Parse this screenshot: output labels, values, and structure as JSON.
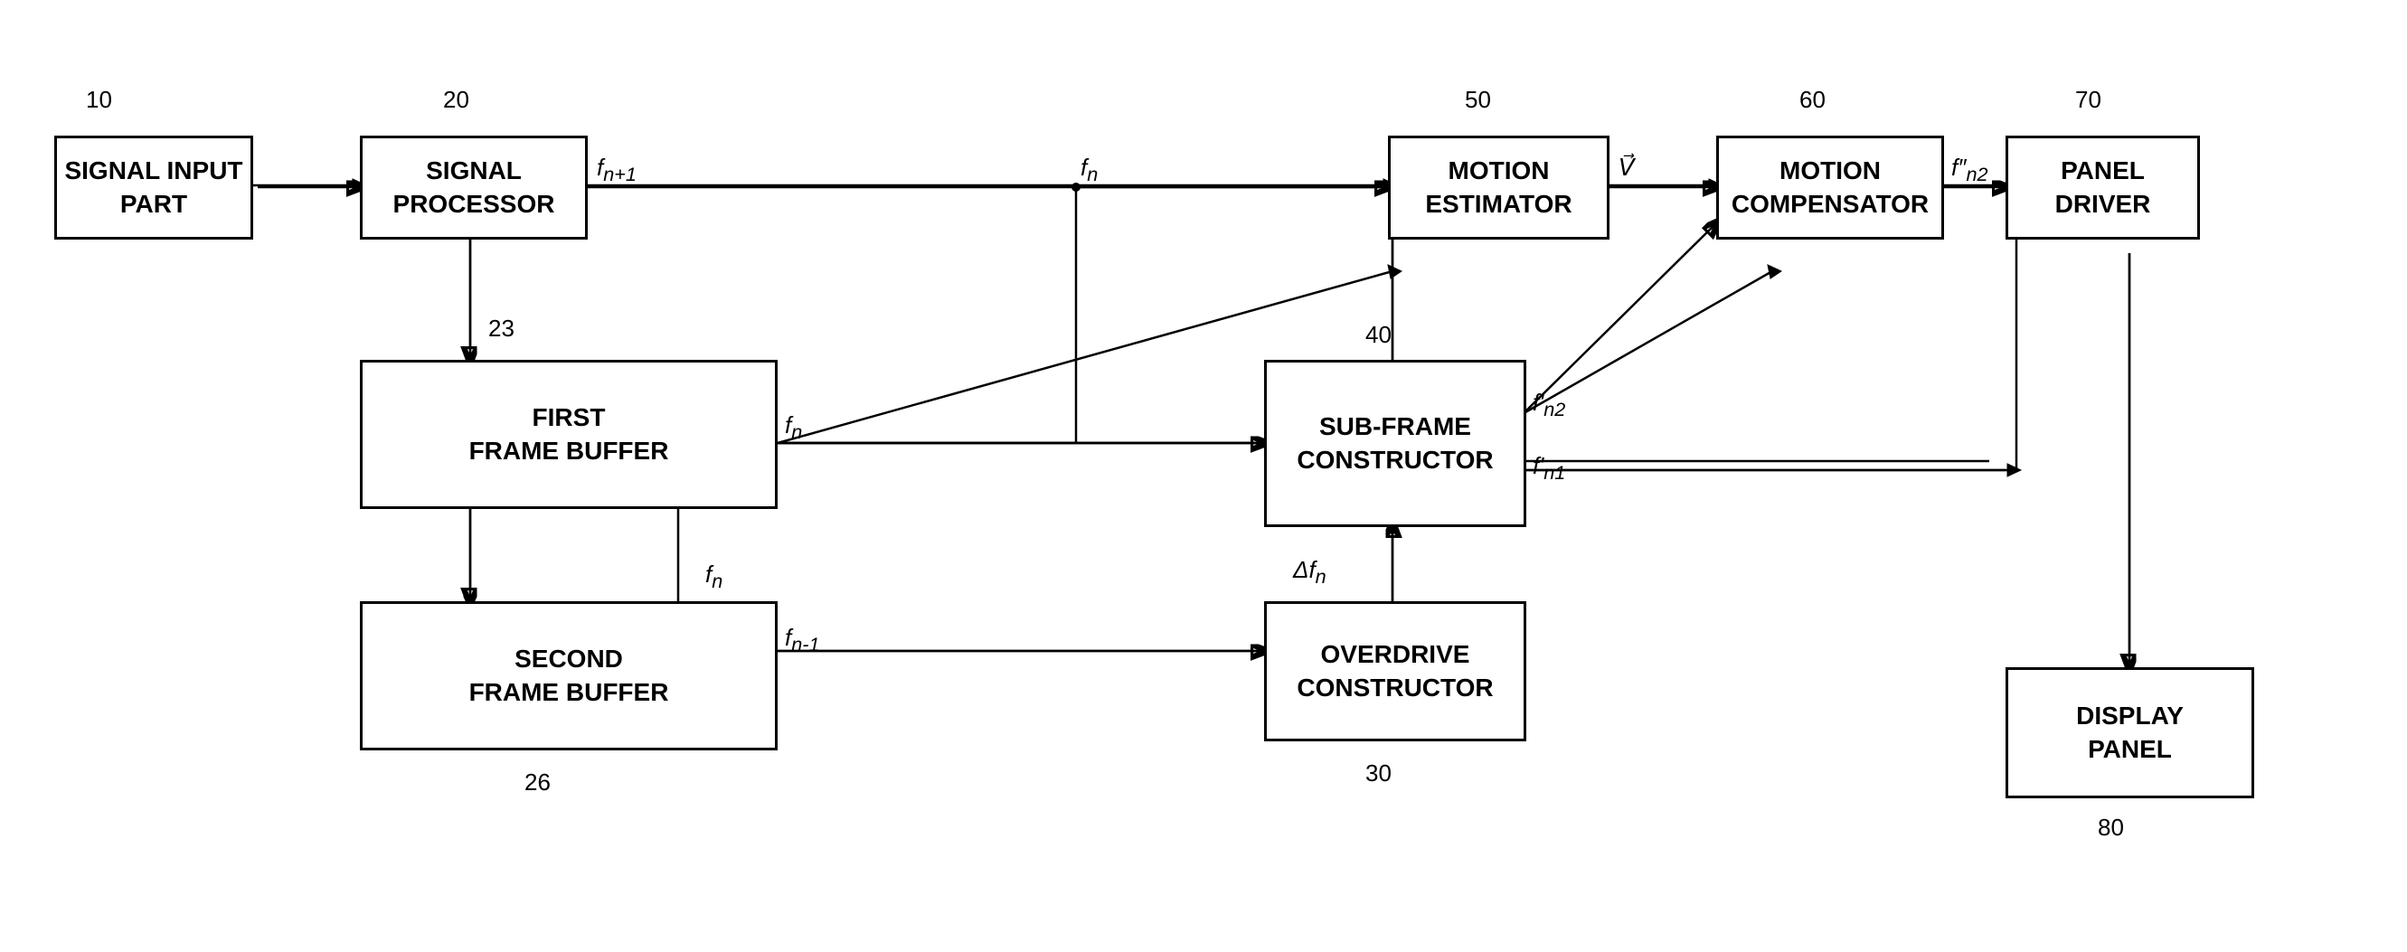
{
  "blocks": {
    "signal_input": {
      "label": "SIGNAL\nINPUT PART",
      "id_num": "10"
    },
    "signal_processor": {
      "label": "SIGNAL\nPROCESSOR",
      "id_num": "20"
    },
    "first_frame_buffer": {
      "label": "FIRST\nFRAME BUFFER",
      "id_num": "23"
    },
    "second_frame_buffer": {
      "label": "SECOND\nFRAME BUFFER",
      "id_num": "26"
    },
    "overdrive_constructor": {
      "label": "OVERDRIVE\nCONSTRUCTOR",
      "id_num": "30"
    },
    "subframe_constructor": {
      "label": "SUB-FRAME\nCONSTRUCTOR",
      "id_num": "40"
    },
    "motion_estimator": {
      "label": "MOTION\nESTIMATOR",
      "id_num": "50"
    },
    "motion_compensator": {
      "label": "MOTION\nCOMPENSATOR",
      "id_num": "60"
    },
    "panel_driver": {
      "label": "PANEL\nDRIVER",
      "id_num": "70"
    },
    "display_panel": {
      "label": "DISPLAY\nPANEL",
      "id_num": "80"
    }
  },
  "signal_labels": {
    "fn1": "fₙ₊₁",
    "fn_top": "fₙ",
    "fn_first": "fₙ",
    "fn_1": "fₙ₋₁",
    "fn2_prime": "f'ₙ₂",
    "fn1_prime": "f'ₙ₁",
    "delta_fn": "Δfₙ",
    "v_arrow": "V⃗",
    "fn2_double": "fₙ₂’’"
  }
}
